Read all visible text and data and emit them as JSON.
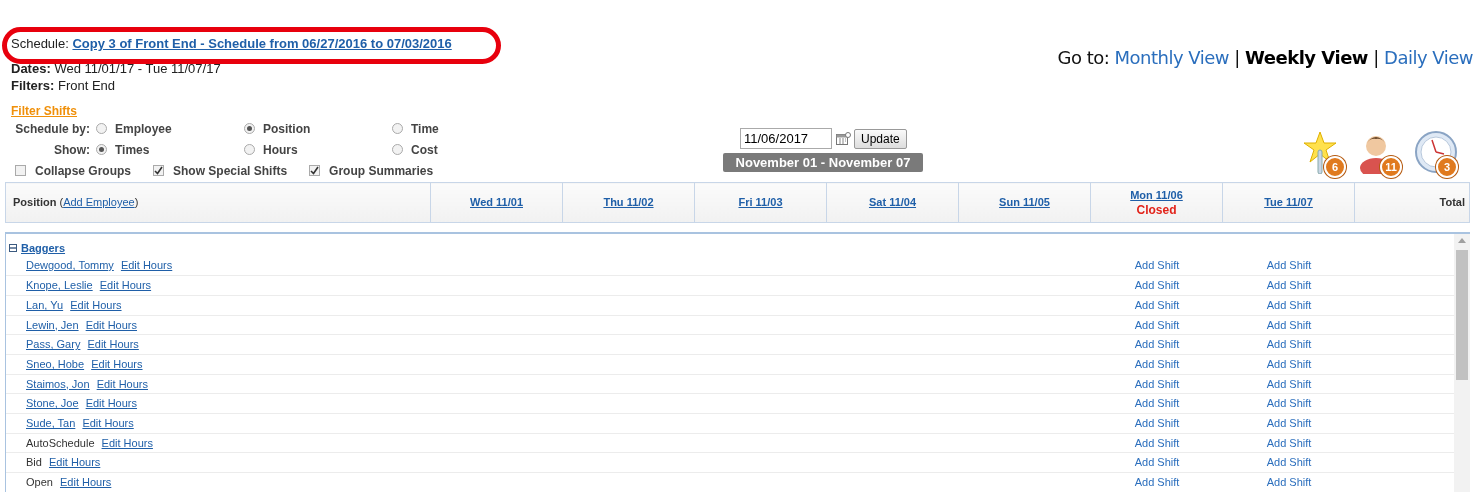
{
  "annotation": {
    "kind": "ring",
    "color": "#e8000d"
  },
  "summary": {
    "schedule_label": "Schedule:",
    "schedule_link": "Copy 3 of Front End - Schedule from 06/27/2016 to 07/03/2016",
    "dates_label": "Dates:",
    "dates_value": "Wed 11/01/17 - Tue 11/07/17",
    "filters_label": "Filters:",
    "filters_value": "Front End"
  },
  "goto": {
    "label": "Go to:",
    "separator": "|",
    "views": [
      {
        "label": "Monthly View",
        "selected": false
      },
      {
        "label": "Weekly View",
        "selected": true
      },
      {
        "label": "Daily View",
        "selected": false
      }
    ]
  },
  "filter_shifts": "Filter Shifts",
  "schedule_by": {
    "label": "Schedule by:",
    "options": [
      {
        "label": "Employee",
        "selected": false
      },
      {
        "label": "Position",
        "selected": true
      },
      {
        "label": "Time",
        "selected": false
      }
    ]
  },
  "show": {
    "label": "Show:",
    "options": [
      {
        "label": "Times",
        "selected": true
      },
      {
        "label": "Hours",
        "selected": false
      },
      {
        "label": "Cost",
        "selected": false
      }
    ]
  },
  "toggles": [
    {
      "label": "Collapse Groups",
      "checked": false
    },
    {
      "label": "Show Special Shifts",
      "checked": true
    },
    {
      "label": "Group Summaries",
      "checked": true
    }
  ],
  "date_field": {
    "value": "11/06/2017"
  },
  "update_button": "Update",
  "week_range": "November 01 - November 07",
  "badges": [
    {
      "kind": "star",
      "count": "6"
    },
    {
      "kind": "person",
      "count": "11"
    },
    {
      "kind": "clock",
      "count": "3"
    }
  ],
  "table": {
    "first_column": {
      "label": "Position",
      "open_bracket": "(",
      "link": "Add Employee",
      "close_bracket": ")"
    },
    "columns": [
      {
        "label": "Wed 11/01"
      },
      {
        "label": "Thu 11/02"
      },
      {
        "label": "Fri 11/03"
      },
      {
        "label": "Sat 11/04"
      },
      {
        "label": "Sun 11/05"
      },
      {
        "label": "Mon 11/06",
        "note": "Closed"
      },
      {
        "label": "Tue 11/07"
      }
    ],
    "total_column": "Total",
    "groups": [
      {
        "name": "Baggers",
        "expanded": true,
        "rows": [
          {
            "kind": "employee",
            "name": "Dewgood, Tommy",
            "edit": "Edit Hours",
            "cells": [
              null,
              null,
              null,
              null,
              null,
              "Add Shift",
              "Add Shift"
            ]
          },
          {
            "kind": "employee",
            "name": "Knope, Leslie",
            "edit": "Edit Hours",
            "cells": [
              null,
              null,
              null,
              null,
              null,
              "Add Shift",
              "Add Shift"
            ]
          },
          {
            "kind": "employee",
            "name": "Lan, Yu",
            "edit": "Edit Hours",
            "cells": [
              null,
              null,
              null,
              null,
              null,
              "Add Shift",
              "Add Shift"
            ]
          },
          {
            "kind": "employee",
            "name": "Lewin, Jen",
            "edit": "Edit Hours",
            "cells": [
              null,
              null,
              null,
              null,
              null,
              "Add Shift",
              "Add Shift"
            ]
          },
          {
            "kind": "employee",
            "name": "Pass, Gary",
            "edit": "Edit Hours",
            "cells": [
              null,
              null,
              null,
              null,
              null,
              "Add Shift",
              "Add Shift"
            ]
          },
          {
            "kind": "employee",
            "name": "Sneo, Hobe",
            "edit": "Edit Hours",
            "cells": [
              null,
              null,
              null,
              null,
              null,
              "Add Shift",
              "Add Shift"
            ]
          },
          {
            "kind": "employee",
            "name": "Staimos, Jon",
            "edit": "Edit Hours",
            "cells": [
              null,
              null,
              null,
              null,
              null,
              "Add Shift",
              "Add Shift"
            ]
          },
          {
            "kind": "employee",
            "name": "Stone, Joe",
            "edit": "Edit Hours",
            "cells": [
              null,
              null,
              null,
              null,
              null,
              "Add Shift",
              "Add Shift"
            ]
          },
          {
            "kind": "employee",
            "name": "Sude, Tan",
            "edit": "Edit Hours",
            "cells": [
              null,
              null,
              null,
              null,
              null,
              "Add Shift",
              "Add Shift"
            ]
          },
          {
            "kind": "slot",
            "name": "AutoSchedule",
            "edit": "Edit Hours",
            "cells": [
              null,
              null,
              null,
              null,
              null,
              "Add Shift",
              "Add Shift"
            ]
          },
          {
            "kind": "slot",
            "name": "Bid",
            "edit": "Edit Hours",
            "cells": [
              null,
              null,
              null,
              null,
              null,
              "Add Shift",
              "Add Shift"
            ]
          },
          {
            "kind": "slot",
            "name": "Open",
            "edit": "Edit Hours",
            "cells": [
              null,
              null,
              null,
              null,
              null,
              "Add Shift",
              "Add Shift"
            ]
          }
        ]
      }
    ]
  }
}
